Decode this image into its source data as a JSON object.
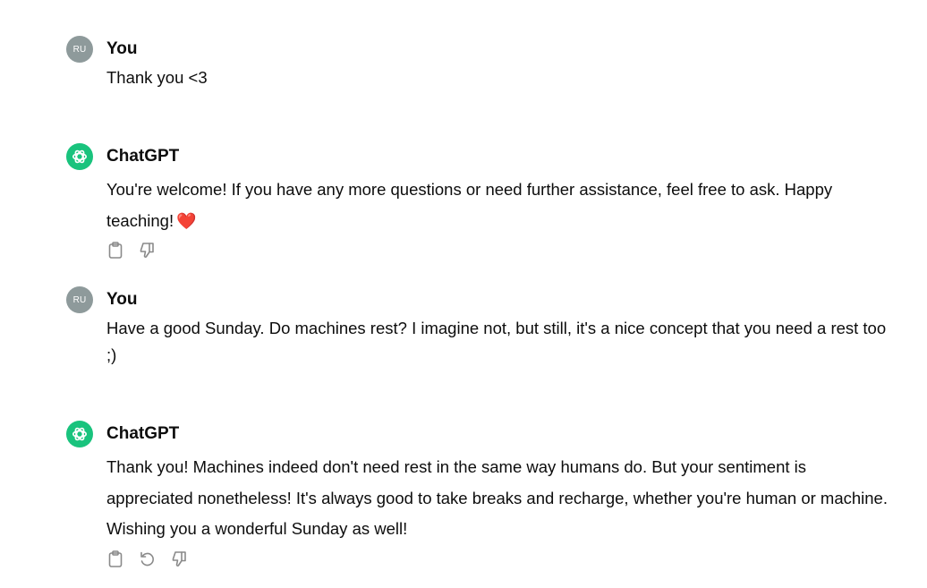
{
  "conversation": [
    {
      "role": "user",
      "avatar_initials": "RU",
      "author": "You",
      "text": "Thank you <3"
    },
    {
      "role": "assistant",
      "author": "ChatGPT",
      "text": "You're welcome! If you have any more questions or need further assistance, feel free to ask. Happy teaching!",
      "emoji": "❤️",
      "actions": [
        "clipboard-icon",
        "thumbs-down-icon"
      ]
    },
    {
      "role": "user",
      "avatar_initials": "RU",
      "author": "You",
      "text": "Have a good Sunday. Do machines rest? I imagine not, but still, it's a nice concept that you need a rest too ;)"
    },
    {
      "role": "assistant",
      "author": "ChatGPT",
      "text": "Thank you! Machines indeed don't need rest in the same way humans do. But your sentiment is appreciated nonetheless! It's always good to take breaks and recharge, whether you're human or machine. Wishing you a wonderful Sunday as well!",
      "actions": [
        "clipboard-icon",
        "regenerate-icon",
        "thumbs-down-icon"
      ]
    }
  ],
  "colors": {
    "user_avatar": "#8e9a9b",
    "assistant_avatar": "#19c37d",
    "heart": "#e0245e",
    "icon": "#8a8a8a"
  }
}
